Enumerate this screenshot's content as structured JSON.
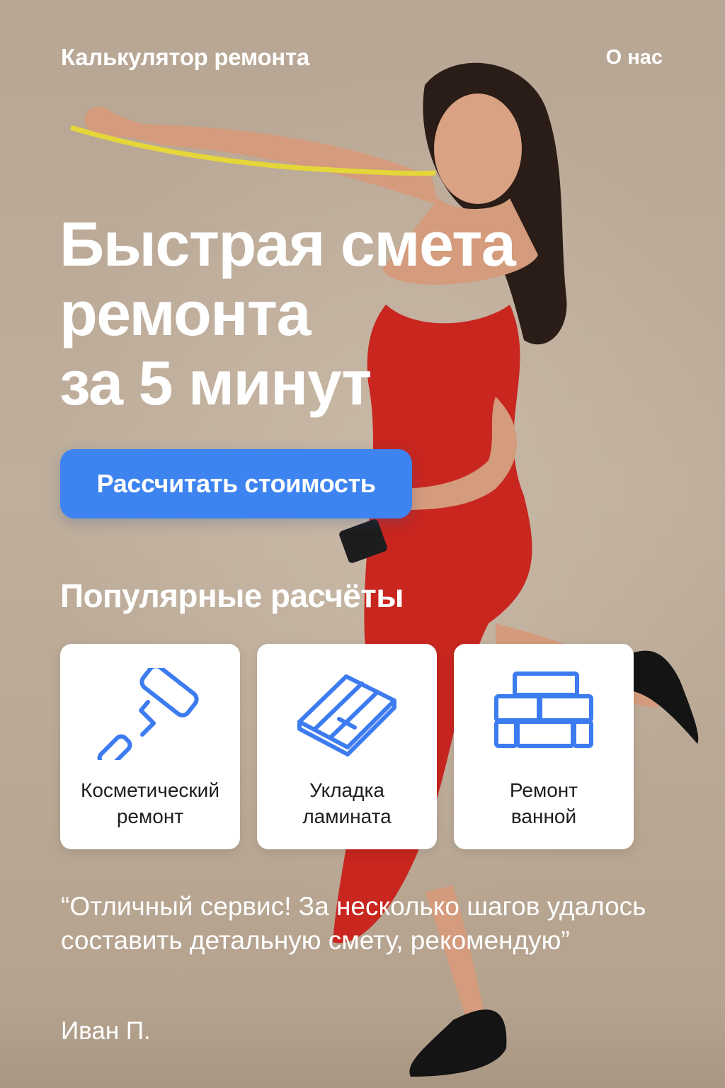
{
  "header": {
    "brand": "Калькулятор ремонта",
    "nav_about": "О нас"
  },
  "hero": {
    "title_lines": [
      "Быстрая смета",
      "ремонта",
      "за 5 минут"
    ],
    "cta_label": "Рассчитать стоимость"
  },
  "popular": {
    "title": "Популярные расчёты",
    "items": [
      {
        "icon": "paint-roller-icon",
        "label_lines": [
          "Косметический",
          "ремонт"
        ]
      },
      {
        "icon": "laminate-icon",
        "label_lines": [
          "Укладка",
          "ламината"
        ]
      },
      {
        "icon": "brick-wall-icon",
        "label_lines": [
          "Ремонт",
          "ванной"
        ]
      }
    ]
  },
  "testimonial": {
    "quote": "“Отличный сервис! За несколько шагов удалось составить детальную смету, рекомендую”",
    "author": "Иван П."
  },
  "colors": {
    "accent": "#3d84f0",
    "icon": "#3d7cf0",
    "dress": "#c8261f",
    "background": "#bfae9b"
  }
}
